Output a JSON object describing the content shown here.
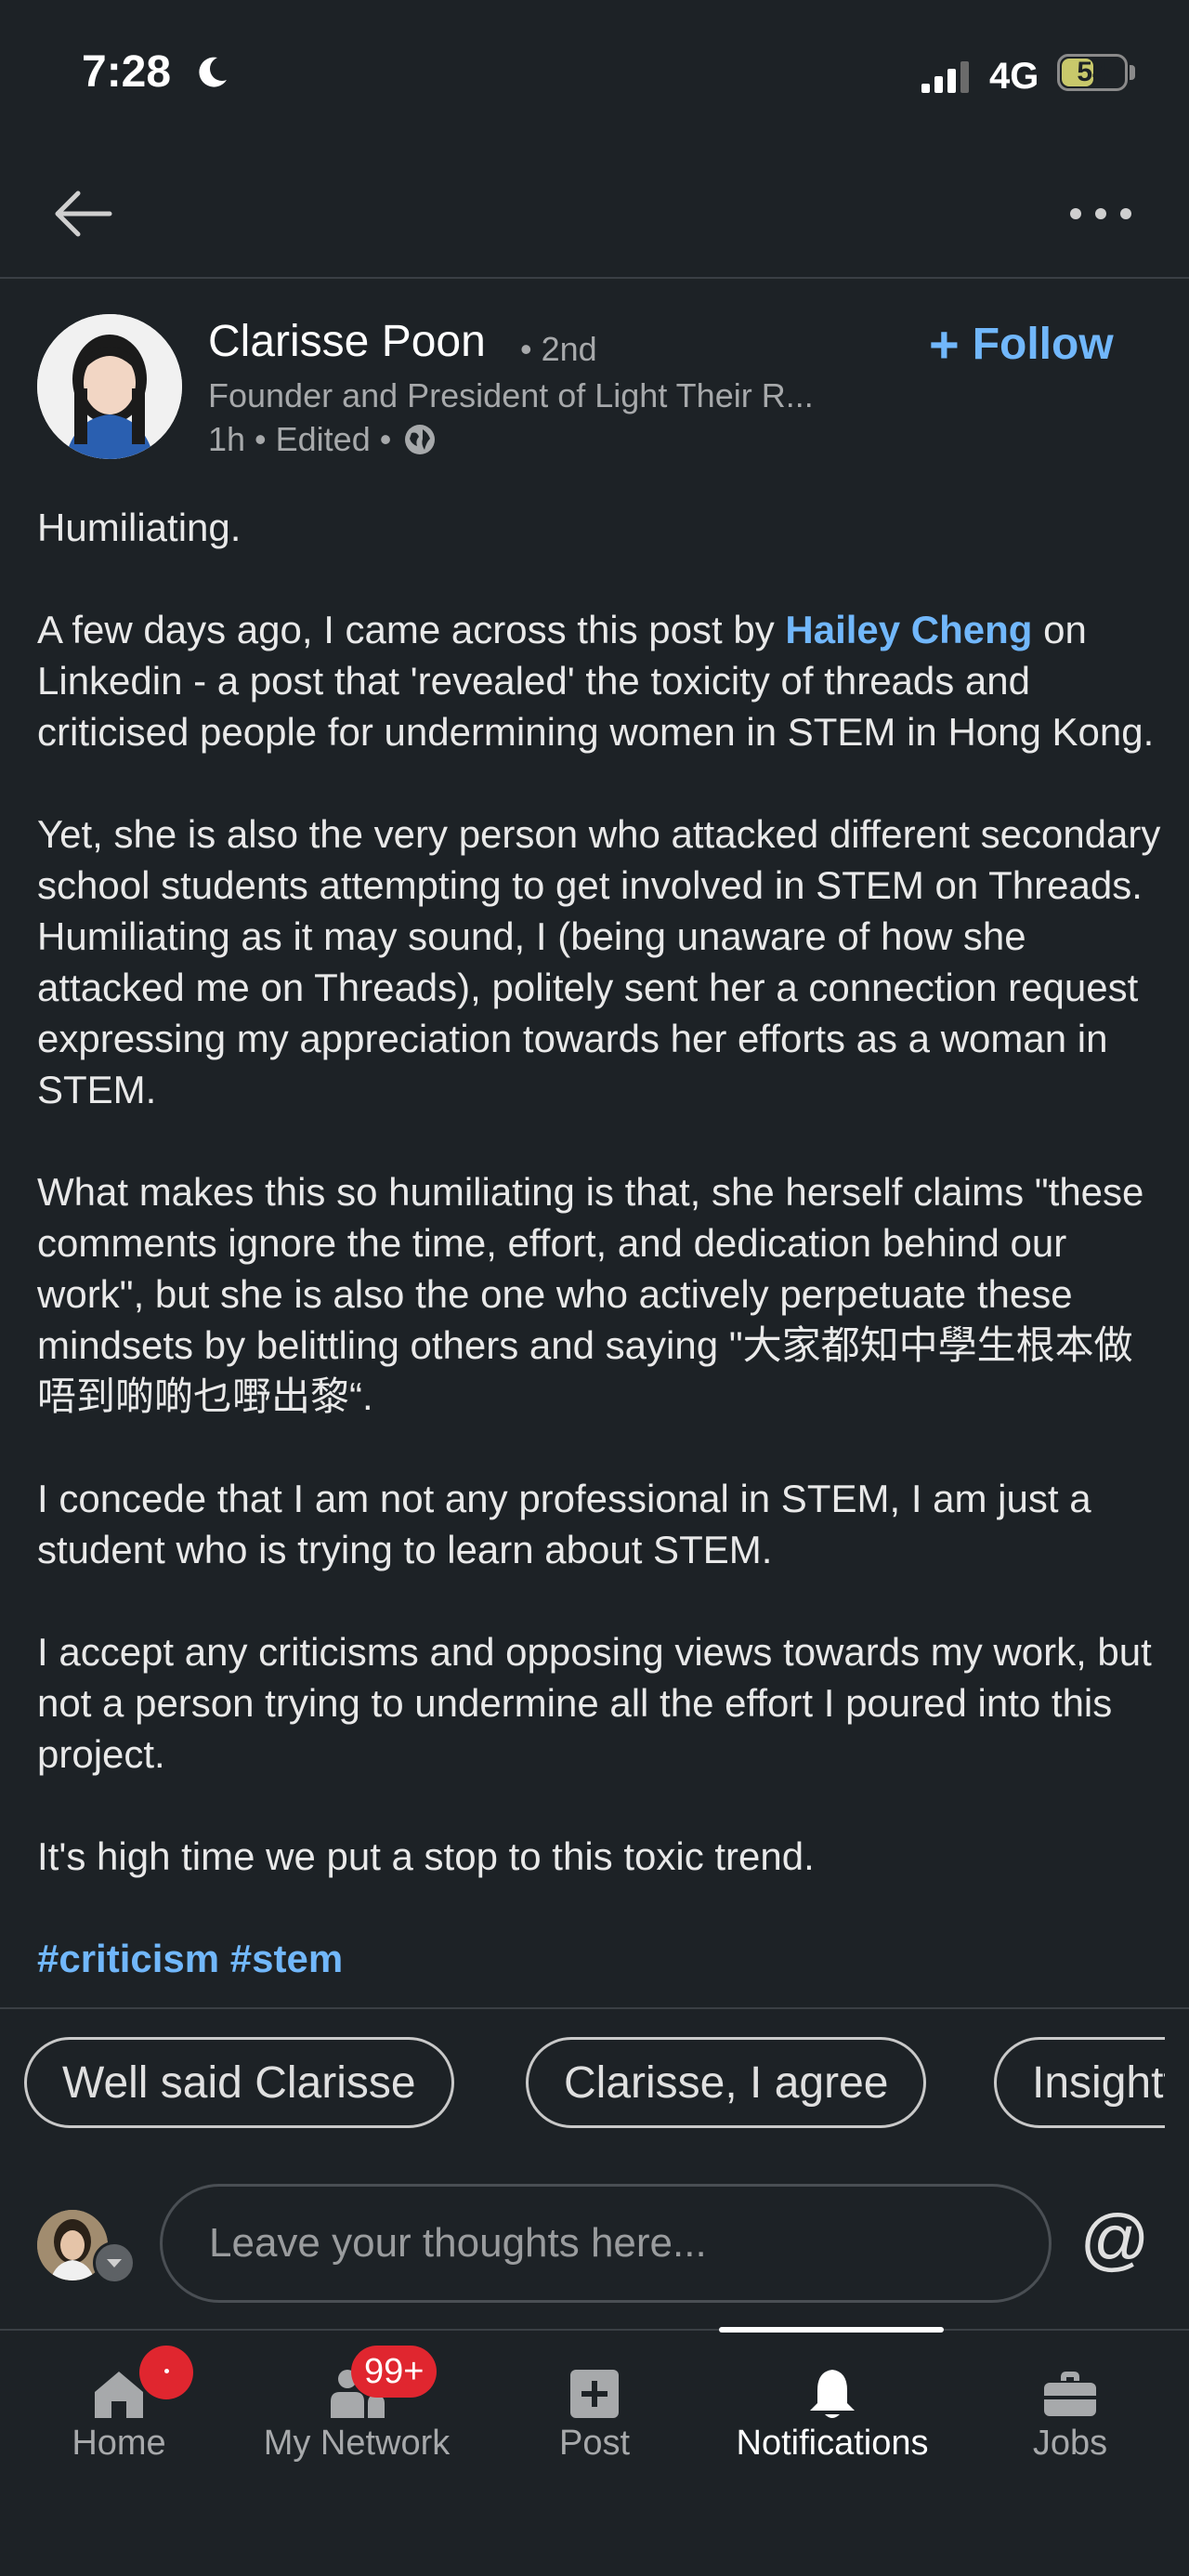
{
  "status_bar": {
    "time": "7:28",
    "network": "4G",
    "battery": "54",
    "battery_level": 0.54
  },
  "post": {
    "author": {
      "name": "Clarisse Poon",
      "degree": "• 2nd",
      "headline": "Founder and President of Light Their R...",
      "meta": "1h • Edited •"
    },
    "follow_label": "Follow",
    "body": {
      "p1": "Humiliating.",
      "p2_before": "A few days ago, I came across this post by ",
      "p2_mention": "Hailey Cheng",
      "p2_after": " on Linkedin - a post that 'revealed' the toxicity of threads and criticised people for undermining women in STEM in Hong Kong.",
      "p3": "Yet, she is also the very person who attacked different secondary school students attempting to get involved in STEM on Threads. Humiliating as it may sound, I (being unaware of how she attacked me on Threads), politely sent her a connection request expressing my appreciation towards her efforts as a woman in STEM.",
      "p4": "What makes this so humiliating is that, she herself claims \"these comments ignore the time, effort, and dedication behind our work\", but she is also the one who actively perpetuate these mindsets by belittling others and saying \"大家都知中學生根本做唔到啲啲乜嘢出黎“.",
      "p5": "I concede that I am not any professional in STEM, I am just a student who is trying to learn about STEM.",
      "p6": "I accept any criticisms and opposing views towards my work, but not a person trying to undermine all the effort I poured into this project.",
      "p7": "It's high time we put a stop to this toxic trend.",
      "hashtags": "#criticism #stem"
    }
  },
  "suggestions": [
    "Well said Clarisse",
    "Clarisse, I agree",
    "Insightful"
  ],
  "comment": {
    "placeholder": "Leave your thoughts here..."
  },
  "nav": {
    "items": [
      {
        "label": "Home",
        "icon": "home-icon"
      },
      {
        "label": "My Network",
        "icon": "network-icon",
        "badge": "99+"
      },
      {
        "label": "Post",
        "icon": "post-icon"
      },
      {
        "label": "Notifications",
        "icon": "bell-icon"
      },
      {
        "label": "Jobs",
        "icon": "briefcase-icon"
      }
    ],
    "active": "Notifications"
  },
  "colors": {
    "background": "#1d2226",
    "accent": "#71b7fb",
    "badge": "#e0262f"
  }
}
